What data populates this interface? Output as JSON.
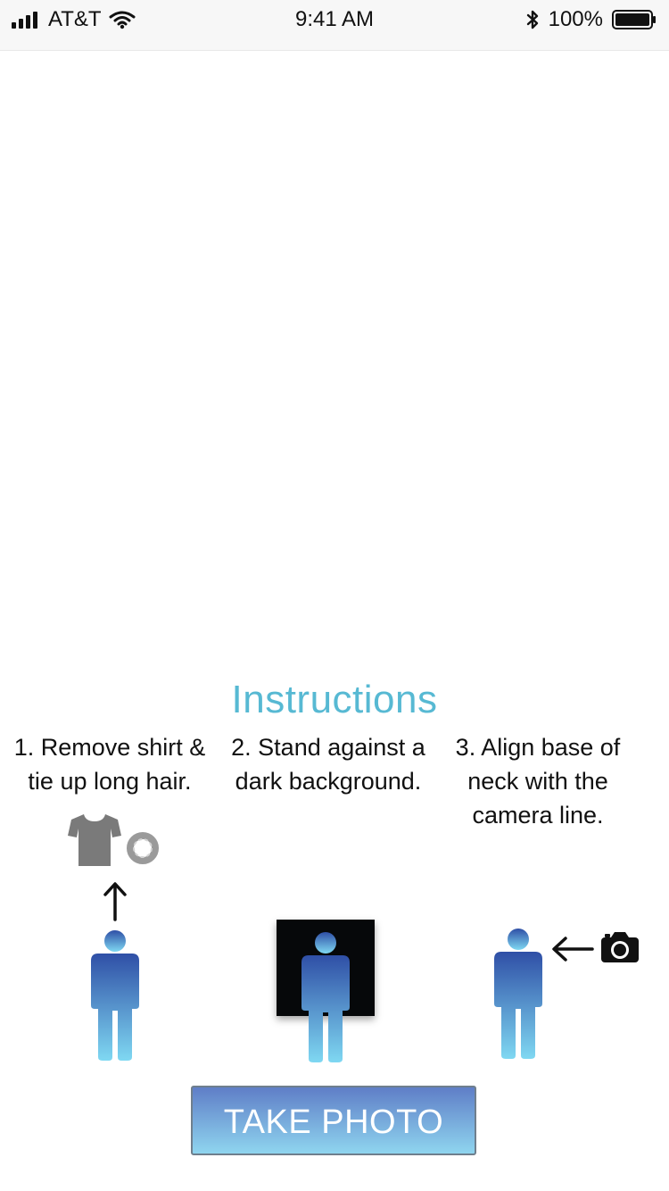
{
  "status_bar": {
    "carrier": "AT&T",
    "time": "9:41 AM",
    "battery": "100%"
  },
  "instructions": {
    "title": "Instructions",
    "steps": [
      {
        "text_line1": "1. Remove shirt &",
        "text_line2": "tie up long hair.",
        "text_line3": ""
      },
      {
        "text_line1": "2. Stand against a",
        "text_line2": "dark background.",
        "text_line3": ""
      },
      {
        "text_line1": "3. Align base of",
        "text_line2": "neck with the",
        "text_line3": "camera line."
      }
    ]
  },
  "buttons": {
    "take_photo_label": "TAKE PHOTO"
  },
  "icons": {
    "shirt": "shirt-icon",
    "scrunchie": "scrunchie-icon",
    "arrow_up": "arrow-up-icon",
    "person": "person-icon",
    "arrow_left": "arrow-left-icon",
    "camera": "camera-icon"
  },
  "colors": {
    "title_gradient_start": "#4f8fd6",
    "title_gradient_end": "#5bd0e6",
    "person_gradient_top": "#2f4fa6",
    "person_gradient_bottom": "#7fd8f2",
    "button_gradient_top": "#5f7ec7",
    "button_gradient_bottom": "#8fd5ef"
  }
}
